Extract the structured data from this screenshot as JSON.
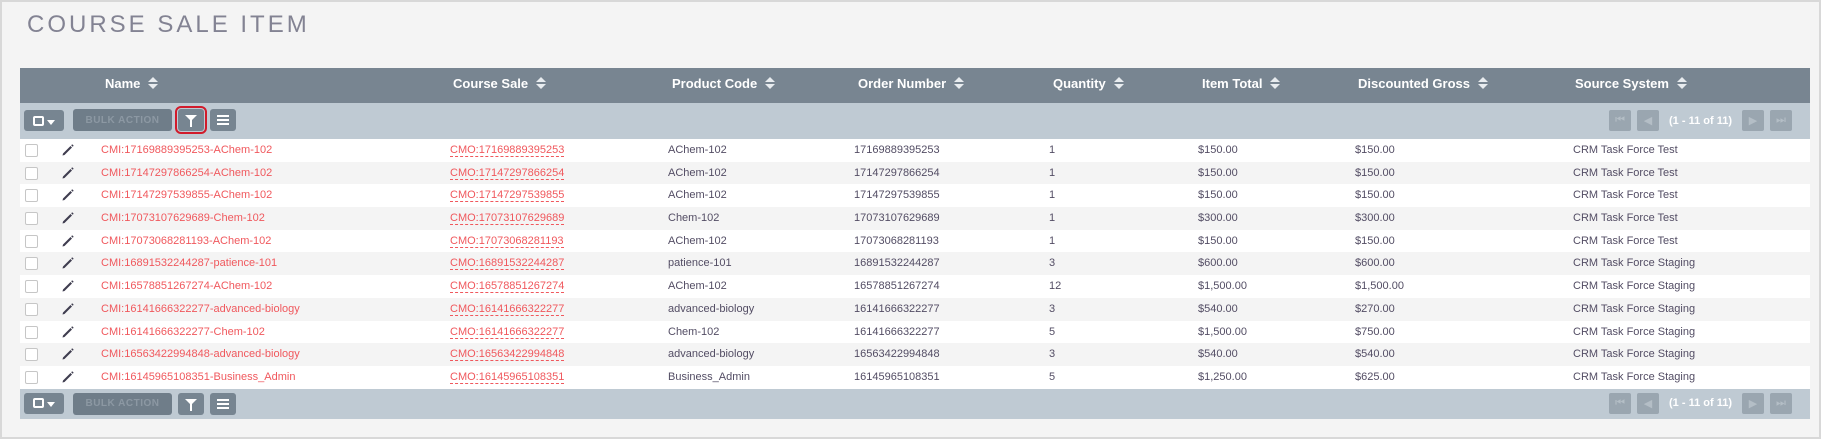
{
  "page": {
    "title": "COURSE SALE ITEM"
  },
  "columns": [
    {
      "key": "name",
      "label": "Name"
    },
    {
      "key": "course_sale",
      "label": "Course Sale"
    },
    {
      "key": "product_code",
      "label": "Product Code"
    },
    {
      "key": "order_number",
      "label": "Order Number"
    },
    {
      "key": "quantity",
      "label": "Quantity"
    },
    {
      "key": "item_total",
      "label": "Item Total"
    },
    {
      "key": "discounted_gross",
      "label": "Discounted Gross"
    },
    {
      "key": "source_system",
      "label": "Source System"
    }
  ],
  "toolbar": {
    "bulk_action_label": "BULK ACTION",
    "pagination_label": "(1 - 11 of 11)"
  },
  "icons": {
    "select": "checkbox-dropdown-icon",
    "filter": "filter-icon",
    "columns": "column-chooser-icon",
    "edit": "pencil-icon",
    "first": "first-page-icon",
    "prev": "prev-page-icon",
    "next": "next-page-icon",
    "last": "last-page-icon"
  },
  "colors": {
    "header_bg": "#788591",
    "toolbar_bg": "#bfcad3",
    "link": "#f0585d",
    "filter_highlight": "#d11b2b"
  },
  "rows": [
    {
      "name": "CMI:17169889395253-AChem-102",
      "course_sale": "CMO:17169889395253",
      "product_code": "AChem-102",
      "order_number": "17169889395253",
      "quantity": "1",
      "item_total": "$150.00",
      "discounted_gross": "$150.00",
      "source_system": "CRM Task Force Test"
    },
    {
      "name": "CMI:17147297866254-AChem-102",
      "course_sale": "CMO:17147297866254",
      "product_code": "AChem-102",
      "order_number": "17147297866254",
      "quantity": "1",
      "item_total": "$150.00",
      "discounted_gross": "$150.00",
      "source_system": "CRM Task Force Test"
    },
    {
      "name": "CMI:17147297539855-AChem-102",
      "course_sale": "CMO:17147297539855",
      "product_code": "AChem-102",
      "order_number": "17147297539855",
      "quantity": "1",
      "item_total": "$150.00",
      "discounted_gross": "$150.00",
      "source_system": "CRM Task Force Test"
    },
    {
      "name": "CMI:17073107629689-Chem-102",
      "course_sale": "CMO:17073107629689",
      "product_code": "Chem-102",
      "order_number": "17073107629689",
      "quantity": "1",
      "item_total": "$300.00",
      "discounted_gross": "$300.00",
      "source_system": "CRM Task Force Test"
    },
    {
      "name": "CMI:17073068281193-AChem-102",
      "course_sale": "CMO:17073068281193",
      "product_code": "AChem-102",
      "order_number": "17073068281193",
      "quantity": "1",
      "item_total": "$150.00",
      "discounted_gross": "$150.00",
      "source_system": "CRM Task Force Test"
    },
    {
      "name": "CMI:16891532244287-patience-101",
      "course_sale": "CMO:16891532244287",
      "product_code": "patience-101",
      "order_number": "16891532244287",
      "quantity": "3",
      "item_total": "$600.00",
      "discounted_gross": "$600.00",
      "source_system": "CRM Task Force Staging"
    },
    {
      "name": "CMI:16578851267274-AChem-102",
      "course_sale": "CMO:16578851267274",
      "product_code": "AChem-102",
      "order_number": "16578851267274",
      "quantity": "12",
      "item_total": "$1,500.00",
      "discounted_gross": "$1,500.00",
      "source_system": "CRM Task Force Staging"
    },
    {
      "name": "CMI:16141666322277-advanced-biology",
      "course_sale": "CMO:16141666322277",
      "product_code": "advanced-biology",
      "order_number": "16141666322277",
      "quantity": "3",
      "item_total": "$540.00",
      "discounted_gross": "$270.00",
      "source_system": "CRM Task Force Staging"
    },
    {
      "name": "CMI:16141666322277-Chem-102",
      "course_sale": "CMO:16141666322277",
      "product_code": "Chem-102",
      "order_number": "16141666322277",
      "quantity": "5",
      "item_total": "$1,500.00",
      "discounted_gross": "$750.00",
      "source_system": "CRM Task Force Staging"
    },
    {
      "name": "CMI:16563422994848-advanced-biology",
      "course_sale": "CMO:16563422994848",
      "product_code": "advanced-biology",
      "order_number": "16563422994848",
      "quantity": "3",
      "item_total": "$540.00",
      "discounted_gross": "$540.00",
      "source_system": "CRM Task Force Staging"
    },
    {
      "name": "CMI:16145965108351-Business_Admin",
      "course_sale": "CMO:16145965108351",
      "product_code": "Business_Admin",
      "order_number": "16145965108351",
      "quantity": "5",
      "item_total": "$1,250.00",
      "discounted_gross": "$625.00",
      "source_system": "CRM Task Force Staging"
    }
  ]
}
